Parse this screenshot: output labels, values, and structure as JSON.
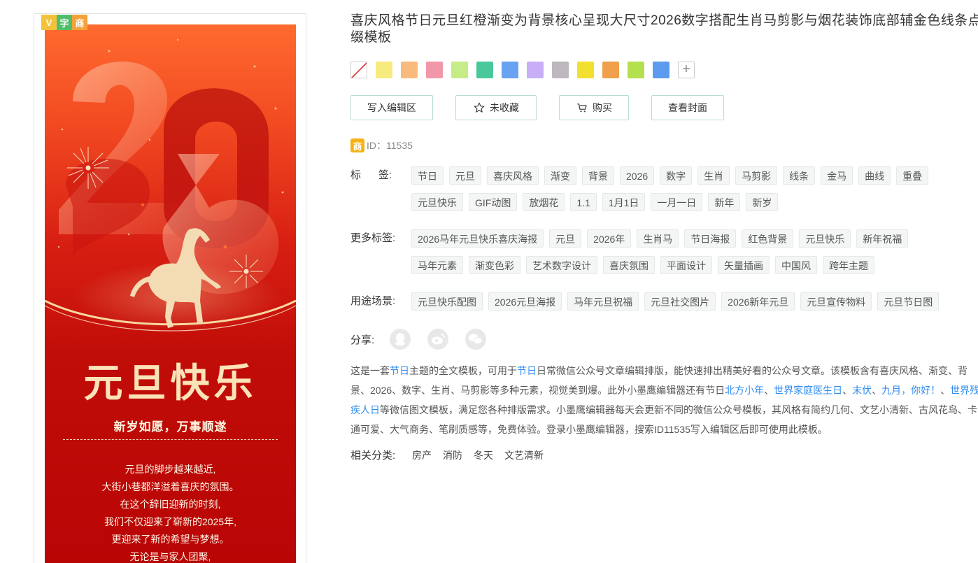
{
  "preview": {
    "badges": [
      "V",
      "字",
      "商"
    ],
    "poster": {
      "big_number": "2026",
      "title": "元旦快乐",
      "subtitle": "新岁如愿，万事顺遂",
      "lines": [
        "元旦的脚步越来越近,",
        "大街小巷都洋溢着喜庆的氛围。",
        "在这个辞旧迎新的时刻,",
        "我们不仅迎来了崭新的2025年,",
        "更迎来了新的希望与梦想。",
        "无论是与家人团聚,"
      ]
    }
  },
  "info": {
    "title": "喜庆风格节日元旦红橙渐变为背景核心呈现大尺寸2026数字搭配生肖马剪影与烟花装饰底部辅金色线条点缀模板",
    "swatches": [
      "#f7ea7e",
      "#f8bb7d",
      "#f297a9",
      "#c6ec87",
      "#49c99b",
      "#6aa2f2",
      "#c8aef7",
      "#bdb8be",
      "#f2e030",
      "#f0a04a",
      "#b4e04d",
      "#5b9cf0"
    ],
    "actions": {
      "write": "写入编辑区",
      "favorite": "未收藏",
      "buy": "购买",
      "cover": "查看封面"
    },
    "id_badge": "商",
    "id_text": "ID：11535",
    "tags_label": "标      签:",
    "tags": [
      "节日",
      "元旦",
      "喜庆风格",
      "渐变",
      "背景",
      "2026",
      "数字",
      "生肖",
      "马剪影",
      "线条",
      "金马",
      "曲线",
      "重叠",
      "元旦快乐",
      "GIF动图",
      "放烟花",
      "1.1",
      "1月1日",
      "一月一日",
      "新年",
      "新岁"
    ],
    "more_tags_label": "更多标签:",
    "more_tags": [
      "2026马年元旦快乐喜庆海报",
      "元旦",
      "2026年",
      "生肖马",
      "节日海报",
      "红色背景",
      "元旦快乐",
      "新年祝福",
      "马年元素",
      "渐变色彩",
      "艺术数字设计",
      "喜庆氛围",
      "平面设计",
      "矢量插画",
      "中国风",
      "跨年主题"
    ],
    "usage_label": "用途场景:",
    "usage": [
      "元旦快乐配图",
      "2026元旦海报",
      "马年元旦祝福",
      "元旦社交图片",
      "2026新年元旦",
      "元旦宣传物料",
      "元旦节日图"
    ],
    "share_label": "分享:",
    "share_icons": [
      "qq-icon",
      "weibo-icon",
      "wechat-icon"
    ],
    "desc": {
      "p1": "这是一套",
      "l1": "节日",
      "p2": "主题的全文模板，可用于",
      "l2": "节日",
      "p3": "日常微信公众号文章编辑排版，能快速排出精美好看的公众号文章。该模板含有喜庆风格、渐变、背景、2026、数字、生肖、马剪影等多种元素，视觉美到爆。此外小墨鹰编辑器还有节日",
      "l3": "北方小年",
      "s1": "、",
      "l4": "世界家庭医生日",
      "s2": "、",
      "l5": "末伏",
      "s3": "、",
      "l6": "九月，你好！",
      "s4": "、",
      "l7": "世界残疾人日",
      "p4": "等微信图文模板，满足您各种排版需求。小墨鹰编辑器每天会更新不同的微信公众号模板，其风格有简约几何、文艺小清新、古风花鸟、卡通可爱、大气商务、笔刷质感等，免费体验。登录小墨鹰编辑器，搜索ID11535写入编辑区后即可使用此模板。"
    },
    "categories_label": "相关分类:",
    "categories": [
      "房产",
      "消防",
      "冬天",
      "文艺清新"
    ]
  }
}
